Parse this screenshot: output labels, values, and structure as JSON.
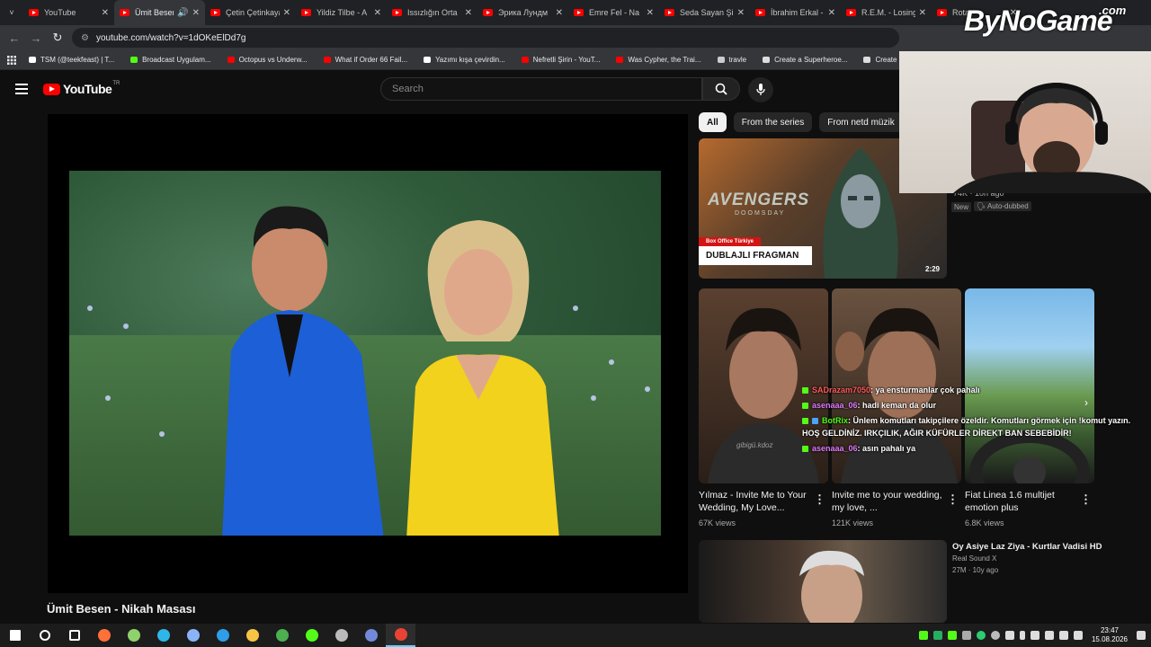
{
  "browser": {
    "tab_menu": "˅",
    "tabs": [
      {
        "label": "YouTube",
        "active": false
      },
      {
        "label": "Ümit Besen",
        "active": true
      },
      {
        "label": "Çetin Çetinkaya",
        "active": false
      },
      {
        "label": "Yildiz Tilbe - A",
        "active": false
      },
      {
        "label": "Issızlığın Orta",
        "active": false
      },
      {
        "label": "Эрика Лундм",
        "active": false
      },
      {
        "label": "Emre Fel - Na",
        "active": false
      },
      {
        "label": "Seda Sayan Şi",
        "active": false
      },
      {
        "label": "İbrahim Erkal -",
        "active": false
      },
      {
        "label": "R.E.M. - Losing",
        "active": false
      },
      {
        "label": "Rota -",
        "active": false
      }
    ],
    "url": "youtube.com/watch?v=1dOKeElDd7g",
    "bookmarks": [
      {
        "label": "TSM (@teekfeast) | T...",
        "color": "#ffffff"
      },
      {
        "label": "Broadcast Uygulam...",
        "color": "#53fc18"
      },
      {
        "label": "Octopus vs Underw...",
        "color": "#ff0000"
      },
      {
        "label": "What if Order 66 Fail...",
        "color": "#ff0000"
      },
      {
        "label": "Yazımı kışa çevirdin...",
        "color": "#ffffff"
      },
      {
        "label": "Nefretli Şirin - YouT...",
        "color": "#ff0000"
      },
      {
        "label": "Was Cypher, the Trai...",
        "color": "#ff0000"
      },
      {
        "label": "travle",
        "color": "#cccccc"
      },
      {
        "label": "Create a Superheroe...",
        "color": "#dddddd"
      },
      {
        "label": "Create a Star Wars C...",
        "color": "#dddddd"
      }
    ]
  },
  "brand": {
    "name": "ByNoGame",
    "suffix": ".com"
  },
  "youtube": {
    "logo_text": "YouTube",
    "region": "TR",
    "search_placeholder": "Search",
    "video_title": "Ümit Besen - Nikah Masası",
    "chips": [
      "All",
      "From the series",
      "From netd müzik",
      "F"
    ]
  },
  "recommendations": {
    "featured": {
      "thumb_title": "AVENGERS",
      "thumb_sub": "DOOMSDAY",
      "tag": "Box Office Türkiye",
      "banner": "DUBLAJLI FRAGMAN",
      "duration": "2:29",
      "meta": "74K · 10h ago",
      "badge_new": "New",
      "badge_dub": "Auto-dubbed"
    },
    "shorts": [
      {
        "title": "Yılmaz - Invite Me to Your Wedding, My Love...",
        "views": "67K views"
      },
      {
        "title": "Invite me to your wedding, my love, ...",
        "views": "121K views"
      },
      {
        "title": "Fiat Linea 1.6 multijet emotion plus",
        "views": "6.8K views"
      }
    ],
    "watermark": "gibigü.kdoz",
    "next": {
      "title": "Oy Asiye Laz Ziya - Kurtlar Vadisi HD",
      "channel": "Real Sound X",
      "meta": "27M · 10y ago"
    }
  },
  "chat": [
    {
      "user": "SADrazam7050",
      "color": "#ff5b5b",
      "text": ": ya ensturmanlar çok pahalı"
    },
    {
      "user": "asenaaa_06",
      "color": "#e07cff",
      "text": ": hadi keman da olur"
    },
    {
      "user": "BotRix",
      "color": "#53fc18",
      "text": ": Ünlem komutları takipçilere özeldir. Komutları görmek için !komut yazın."
    },
    {
      "user": "",
      "color": "#ffffff",
      "text": "HOŞ GELDİNİZ. IRKÇILIK, AĞIR KÜFÜRLER DİREKT BAN SEBEBİDİR!"
    },
    {
      "user": "asenaaa_06",
      "color": "#e07cff",
      "text": ": asın pahalı ya"
    }
  ],
  "taskbar": {
    "apps": [
      {
        "name": "start-icon",
        "color": "#ffffff"
      },
      {
        "name": "search-icon",
        "color": "#ffffff"
      },
      {
        "name": "task-view-icon",
        "color": "#ffffff"
      },
      {
        "name": "firefox-icon",
        "color": "#ff7139"
      },
      {
        "name": "app-icon",
        "color": "#8fd16a"
      },
      {
        "name": "edge-icon",
        "color": "#2fb5e8"
      },
      {
        "name": "control-panel-icon",
        "color": "#8ab4f8"
      },
      {
        "name": "store-icon",
        "color": "#2f9de8"
      },
      {
        "name": "file-explorer-icon",
        "color": "#f6c445"
      },
      {
        "name": "chrome-icon",
        "color": "#4caf50"
      },
      {
        "name": "obs-like-icon",
        "color": "#53fc18"
      },
      {
        "name": "settings-icon",
        "color": "#bbbbbb"
      },
      {
        "name": "discord-icon",
        "color": "#7289da"
      },
      {
        "name": "chrome-active-icon",
        "color": "#ea4335"
      }
    ],
    "time": "23:47",
    "date": "15.08.2026"
  }
}
